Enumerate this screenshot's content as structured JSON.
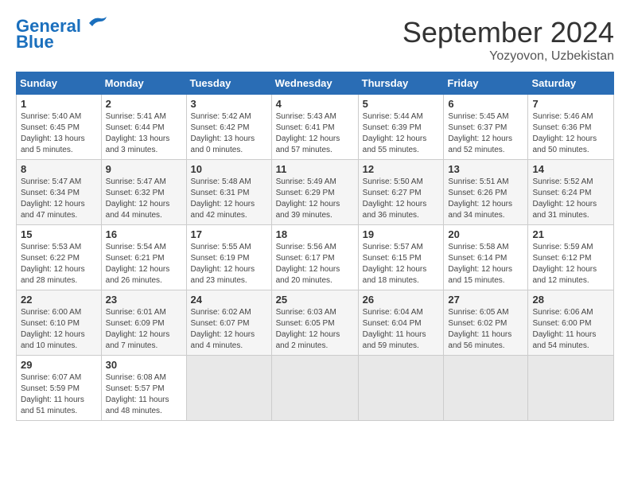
{
  "header": {
    "logo_line1": "General",
    "logo_line2": "Blue",
    "month": "September 2024",
    "location": "Yozyovon, Uzbekistan"
  },
  "weekdays": [
    "Sunday",
    "Monday",
    "Tuesday",
    "Wednesday",
    "Thursday",
    "Friday",
    "Saturday"
  ],
  "weeks": [
    [
      {
        "day": "1",
        "sunrise": "Sunrise: 5:40 AM",
        "sunset": "Sunset: 6:45 PM",
        "daylight": "Daylight: 13 hours and 5 minutes."
      },
      {
        "day": "2",
        "sunrise": "Sunrise: 5:41 AM",
        "sunset": "Sunset: 6:44 PM",
        "daylight": "Daylight: 13 hours and 3 minutes."
      },
      {
        "day": "3",
        "sunrise": "Sunrise: 5:42 AM",
        "sunset": "Sunset: 6:42 PM",
        "daylight": "Daylight: 13 hours and 0 minutes."
      },
      {
        "day": "4",
        "sunrise": "Sunrise: 5:43 AM",
        "sunset": "Sunset: 6:41 PM",
        "daylight": "Daylight: 12 hours and 57 minutes."
      },
      {
        "day": "5",
        "sunrise": "Sunrise: 5:44 AM",
        "sunset": "Sunset: 6:39 PM",
        "daylight": "Daylight: 12 hours and 55 minutes."
      },
      {
        "day": "6",
        "sunrise": "Sunrise: 5:45 AM",
        "sunset": "Sunset: 6:37 PM",
        "daylight": "Daylight: 12 hours and 52 minutes."
      },
      {
        "day": "7",
        "sunrise": "Sunrise: 5:46 AM",
        "sunset": "Sunset: 6:36 PM",
        "daylight": "Daylight: 12 hours and 50 minutes."
      }
    ],
    [
      {
        "day": "8",
        "sunrise": "Sunrise: 5:47 AM",
        "sunset": "Sunset: 6:34 PM",
        "daylight": "Daylight: 12 hours and 47 minutes."
      },
      {
        "day": "9",
        "sunrise": "Sunrise: 5:47 AM",
        "sunset": "Sunset: 6:32 PM",
        "daylight": "Daylight: 12 hours and 44 minutes."
      },
      {
        "day": "10",
        "sunrise": "Sunrise: 5:48 AM",
        "sunset": "Sunset: 6:31 PM",
        "daylight": "Daylight: 12 hours and 42 minutes."
      },
      {
        "day": "11",
        "sunrise": "Sunrise: 5:49 AM",
        "sunset": "Sunset: 6:29 PM",
        "daylight": "Daylight: 12 hours and 39 minutes."
      },
      {
        "day": "12",
        "sunrise": "Sunrise: 5:50 AM",
        "sunset": "Sunset: 6:27 PM",
        "daylight": "Daylight: 12 hours and 36 minutes."
      },
      {
        "day": "13",
        "sunrise": "Sunrise: 5:51 AM",
        "sunset": "Sunset: 6:26 PM",
        "daylight": "Daylight: 12 hours and 34 minutes."
      },
      {
        "day": "14",
        "sunrise": "Sunrise: 5:52 AM",
        "sunset": "Sunset: 6:24 PM",
        "daylight": "Daylight: 12 hours and 31 minutes."
      }
    ],
    [
      {
        "day": "15",
        "sunrise": "Sunrise: 5:53 AM",
        "sunset": "Sunset: 6:22 PM",
        "daylight": "Daylight: 12 hours and 28 minutes."
      },
      {
        "day": "16",
        "sunrise": "Sunrise: 5:54 AM",
        "sunset": "Sunset: 6:21 PM",
        "daylight": "Daylight: 12 hours and 26 minutes."
      },
      {
        "day": "17",
        "sunrise": "Sunrise: 5:55 AM",
        "sunset": "Sunset: 6:19 PM",
        "daylight": "Daylight: 12 hours and 23 minutes."
      },
      {
        "day": "18",
        "sunrise": "Sunrise: 5:56 AM",
        "sunset": "Sunset: 6:17 PM",
        "daylight": "Daylight: 12 hours and 20 minutes."
      },
      {
        "day": "19",
        "sunrise": "Sunrise: 5:57 AM",
        "sunset": "Sunset: 6:15 PM",
        "daylight": "Daylight: 12 hours and 18 minutes."
      },
      {
        "day": "20",
        "sunrise": "Sunrise: 5:58 AM",
        "sunset": "Sunset: 6:14 PM",
        "daylight": "Daylight: 12 hours and 15 minutes."
      },
      {
        "day": "21",
        "sunrise": "Sunrise: 5:59 AM",
        "sunset": "Sunset: 6:12 PM",
        "daylight": "Daylight: 12 hours and 12 minutes."
      }
    ],
    [
      {
        "day": "22",
        "sunrise": "Sunrise: 6:00 AM",
        "sunset": "Sunset: 6:10 PM",
        "daylight": "Daylight: 12 hours and 10 minutes."
      },
      {
        "day": "23",
        "sunrise": "Sunrise: 6:01 AM",
        "sunset": "Sunset: 6:09 PM",
        "daylight": "Daylight: 12 hours and 7 minutes."
      },
      {
        "day": "24",
        "sunrise": "Sunrise: 6:02 AM",
        "sunset": "Sunset: 6:07 PM",
        "daylight": "Daylight: 12 hours and 4 minutes."
      },
      {
        "day": "25",
        "sunrise": "Sunrise: 6:03 AM",
        "sunset": "Sunset: 6:05 PM",
        "daylight": "Daylight: 12 hours and 2 minutes."
      },
      {
        "day": "26",
        "sunrise": "Sunrise: 6:04 AM",
        "sunset": "Sunset: 6:04 PM",
        "daylight": "Daylight: 11 hours and 59 minutes."
      },
      {
        "day": "27",
        "sunrise": "Sunrise: 6:05 AM",
        "sunset": "Sunset: 6:02 PM",
        "daylight": "Daylight: 11 hours and 56 minutes."
      },
      {
        "day": "28",
        "sunrise": "Sunrise: 6:06 AM",
        "sunset": "Sunset: 6:00 PM",
        "daylight": "Daylight: 11 hours and 54 minutes."
      }
    ],
    [
      {
        "day": "29",
        "sunrise": "Sunrise: 6:07 AM",
        "sunset": "Sunset: 5:59 PM",
        "daylight": "Daylight: 11 hours and 51 minutes."
      },
      {
        "day": "30",
        "sunrise": "Sunrise: 6:08 AM",
        "sunset": "Sunset: 5:57 PM",
        "daylight": "Daylight: 11 hours and 48 minutes."
      },
      null,
      null,
      null,
      null,
      null
    ]
  ]
}
